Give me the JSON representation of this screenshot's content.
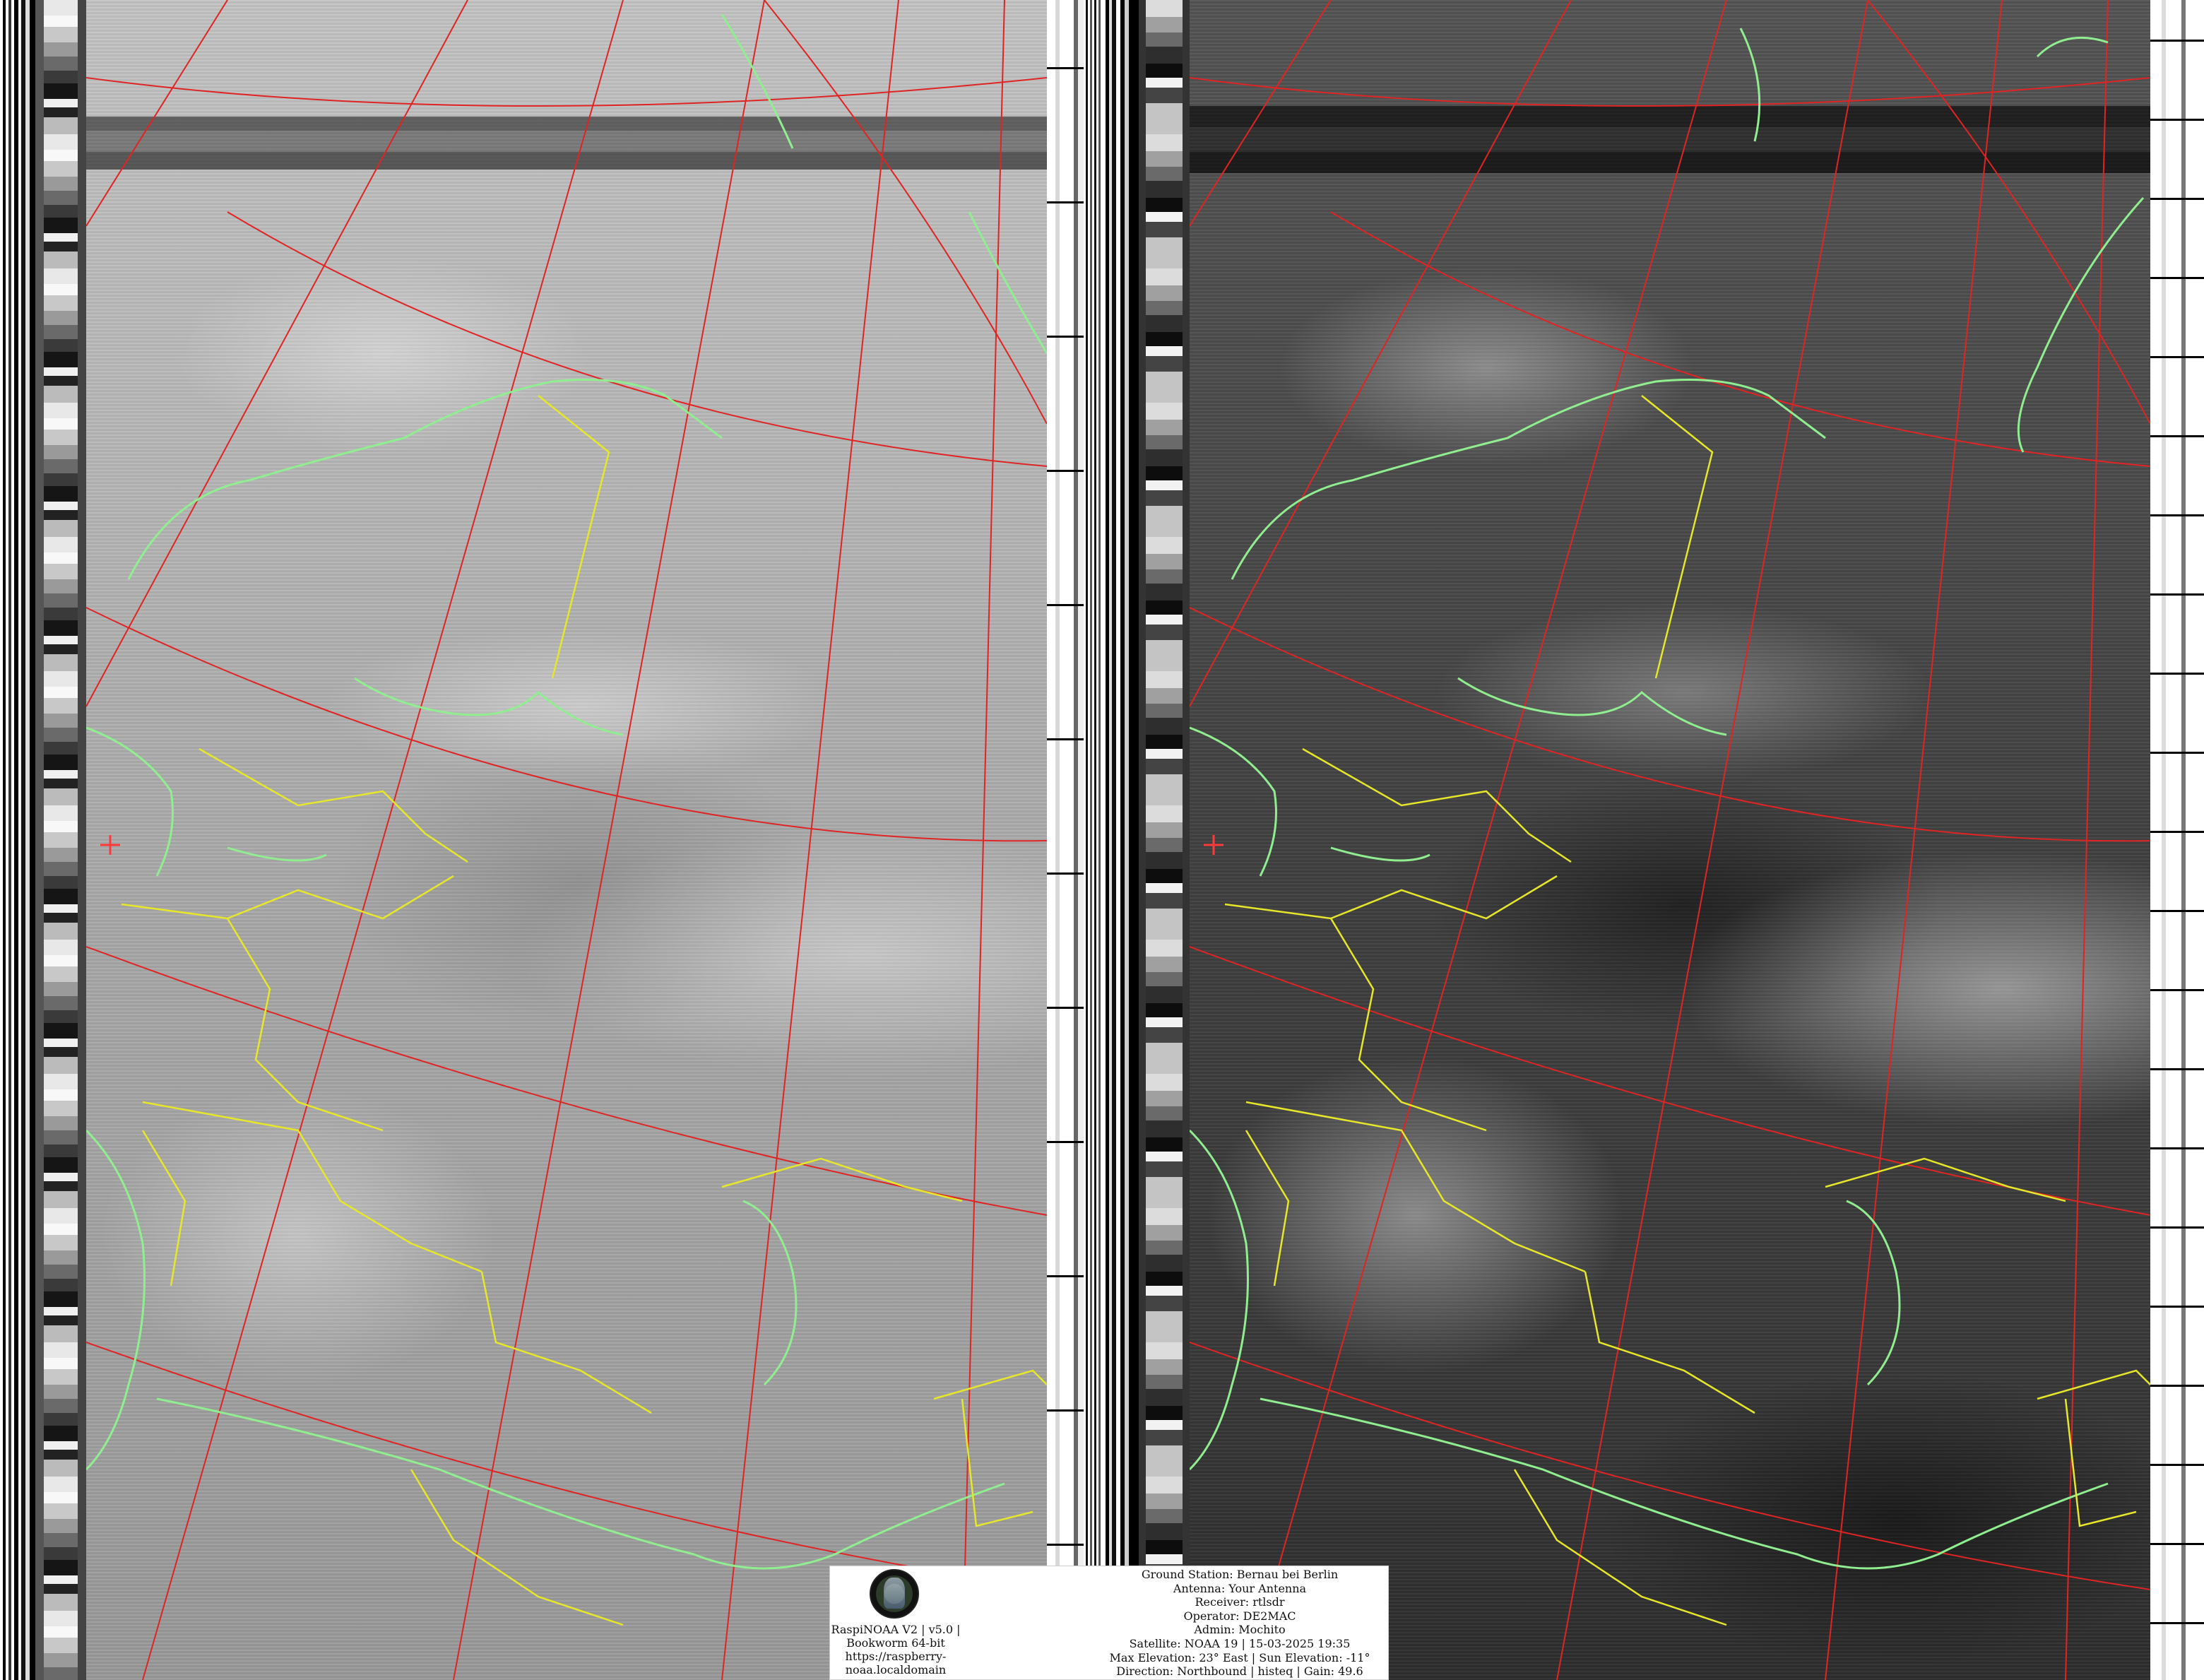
{
  "image_panels": [
    {
      "name": "channel-a-infrared",
      "tone": "light-gray"
    },
    {
      "name": "channel-b-infrared-enhanced",
      "tone": "dark-gray"
    }
  ],
  "overlay_colors": {
    "graticule": "#e02424",
    "coastline": "#90ee90",
    "borders": "#e6e62a",
    "station_marker": "#ff3a3a"
  },
  "legend": {
    "logo_icon": "raspinoaa-globe-logo",
    "left_lines": [
      "RaspiNOAA V2 | v5.0 |",
      "Bookworm 64-bit",
      "https://raspberry-",
      "noaa.localdomain"
    ],
    "right_lines": [
      "Ground Station: Bernau bei Berlin",
      "Antenna: Your Antenna",
      "Receiver: rtlsdr",
      "Operator: DE2MAC",
      "Admin: Mochito",
      "Satellite: NOAA 19 | 15-03-2025 19:35",
      "Max Elevation: 23° East | Sun Elevation: -11°",
      "Direction: Northbound | histeq | Gain: 49.6"
    ]
  }
}
